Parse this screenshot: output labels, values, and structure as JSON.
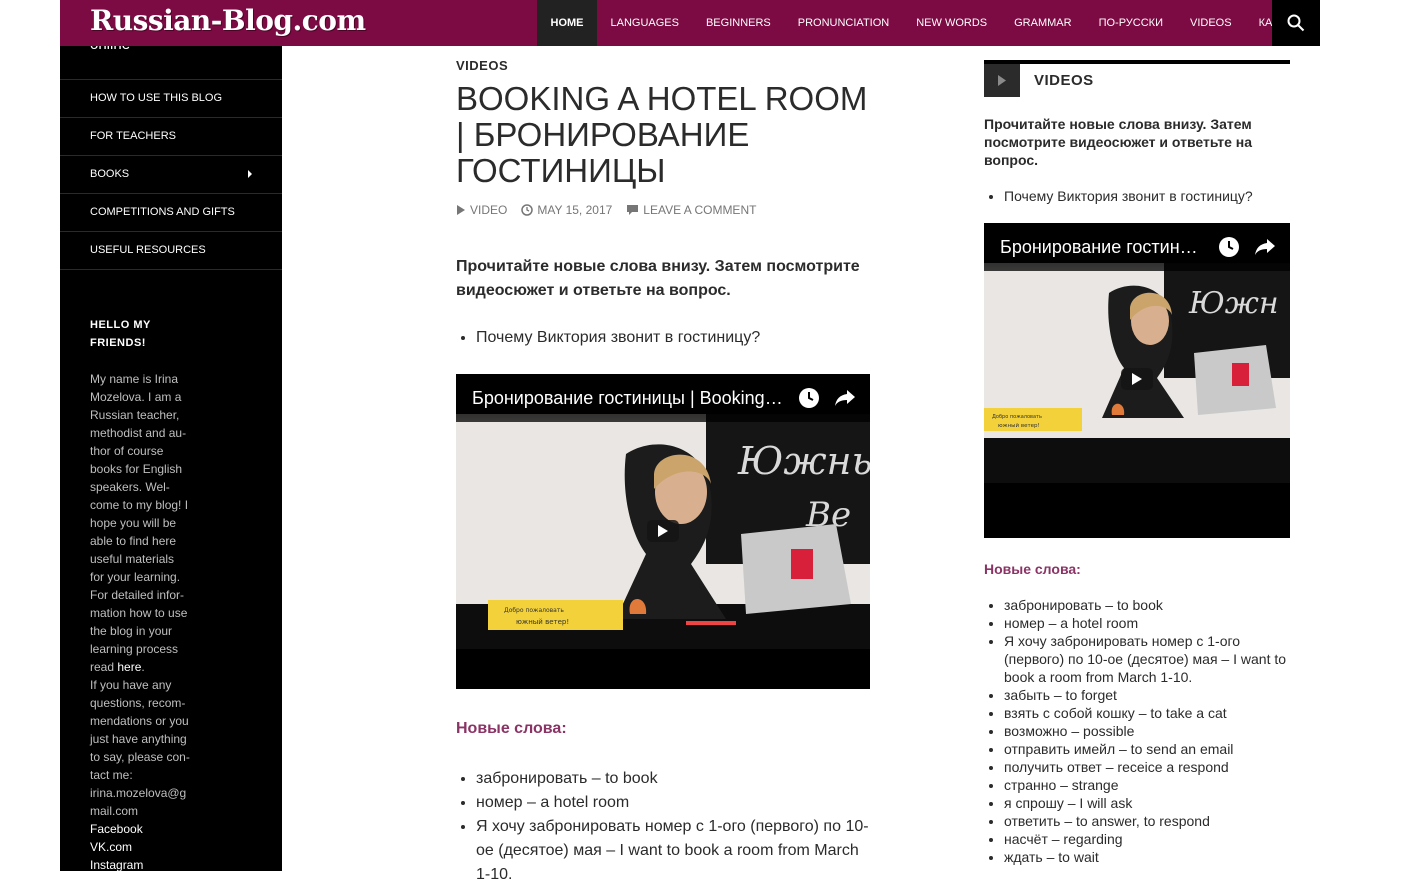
{
  "header": {
    "logo": "Russian-Blog.com",
    "nav": [
      "HOME",
      "LANGUAGES",
      "BEGINNERS",
      "PRONUNCIATION",
      "NEW WORDS",
      "GRAMMAR",
      "ПО-РУССКИ",
      "VIDEOS",
      "КАК ..."
    ],
    "active_nav": "HOME"
  },
  "sidebar": {
    "top_text": "online",
    "menu": [
      "HOW TO USE THIS BLOG",
      "FOR TEACHERS",
      "BOOKS",
      "COMPETITIONS AND GIFTS",
      "USEFUL RESOURCES"
    ],
    "hello_title": "HELLO MY FRIENDS!",
    "bio_lines": [
      "My name is Irina",
      "Mozelova. I am a",
      "Russian teacher,",
      "methodist and au-",
      "thor of course",
      "books for English",
      "speakers. Wel-",
      "come to my blog! I",
      "hope you will be",
      "able to find here",
      "useful materials",
      "for your learning.",
      "For detailed infor-",
      "mation how to use",
      "the blog in your",
      "learning process"
    ],
    "read_here_prefix": "read ",
    "here_link": "here",
    "contact_lines": [
      "If you have any",
      "questions, recom-",
      "mendations or you",
      "just have anything",
      "to say, please con-",
      "tact me:",
      "irina.mozelova@g",
      "mail.com"
    ],
    "social_links": [
      "Facebook",
      "VK.com",
      "Instagram"
    ]
  },
  "article": {
    "category": "VIDEOS",
    "title": "BOOKING A HOTEL ROOM | БРОНИРОВАНИЕ ГОСТИНИЦЫ",
    "meta": {
      "format": "VIDEO",
      "date": "MAY 15, 2017",
      "comment": "LEAVE A COMMENT"
    },
    "intro": "Прочитайте новые слова внизу. Затем посмотрите видеосюжет и ответьте на вопрос.",
    "question": "Почему Виктория звонит в гостиницу?",
    "video_title": "Бронирование гостиницы | Booking a hotel room",
    "new_words_heading": "Новые слова:",
    "vocab": [
      "забронировать – to book",
      "номер – a hotel room",
      "Я хочу забронировать номер с 1-ого (первого) по 10-ое (десятое) мая – I want to book a room from March 1-10."
    ]
  },
  "widget": {
    "title": "VIDEOS",
    "intro": "Прочитайте новые слова внизу. Затем посмотрите видеосюжет и ответьте на вопрос.",
    "question": "Почему Виктория звонит в гостиницу?",
    "video_title": "Бронирование гостиницы | Booking a hotel room",
    "new_words_heading": "Новые слова:",
    "vocab": [
      "забронировать – to book",
      "номер – a hotel room",
      "Я хочу забронировать номер с 1-ого (первого) по 10-ое (десятое) мая – I want to book a room from  March 1-10.",
      "забыть – to forget",
      "взять с собой кошку – to take a cat",
      "возможно – possible",
      "отправить имейл – to send an email",
      "получить ответ – receice a respond",
      "странно – strange",
      "я спрошу – I will ask",
      "ответить – to answer, to respond",
      "насчёт – regarding",
      "ждать – to wait"
    ]
  },
  "colors": {
    "header_bg": "#7c0a43",
    "sidebar_bg": "#000000",
    "accent_heading": "#8a3466"
  }
}
